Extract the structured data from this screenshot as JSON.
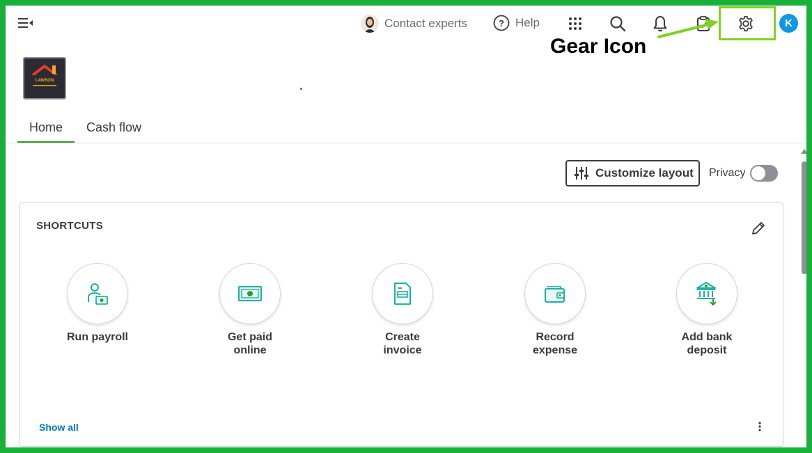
{
  "topbar": {
    "contact_label": "Contact experts",
    "help_label": "Help",
    "user_initial": "K",
    "icons": [
      "menu-collapse-icon",
      "apps-grid-icon",
      "search-icon",
      "bell-icon",
      "clipboard-icon",
      "gear-icon"
    ]
  },
  "annotation": {
    "label": "Gear Icon",
    "highlight_color": "#7ed321"
  },
  "company": {
    "logo_text": "LAWSON"
  },
  "tabs": [
    {
      "label": "Home",
      "active": true
    },
    {
      "label": "Cash flow",
      "active": false
    }
  ],
  "toolbar": {
    "customize_label": "Customize layout",
    "privacy_label": "Privacy",
    "privacy_on": false
  },
  "shortcuts": {
    "title": "SHORTCUTS",
    "items": [
      {
        "label": "Run payroll",
        "icon": "payroll-icon"
      },
      {
        "label": "Get paid online",
        "icon": "cash-icon"
      },
      {
        "label": "Create invoice",
        "icon": "invoice-icon"
      },
      {
        "label": "Record expense",
        "icon": "wallet-icon"
      },
      {
        "label": "Add bank deposit",
        "icon": "bank-icon"
      }
    ],
    "show_all_label": "Show all"
  },
  "colors": {
    "frame_border": "#19b03a",
    "brand_green": "#2ca01c",
    "link_blue": "#0077c5",
    "avatar_blue": "#0d97e4",
    "icon_teal": "#00a89a"
  }
}
